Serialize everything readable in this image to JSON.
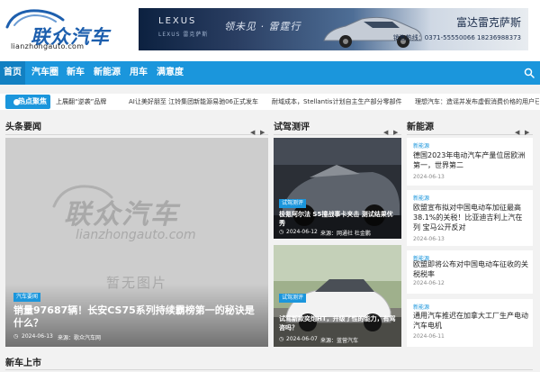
{
  "logo": {
    "text": "联众汽车",
    "url": "lianzhongauto.com",
    "icon": "car-logo-icon",
    "color": "#1d5fae"
  },
  "banner": {
    "brand": "LEXUS",
    "brand_sub": "LEXUS 雷克萨斯",
    "slogan": "领未见 · 雷霆行",
    "dealer": "富达雷克萨斯",
    "phone": "销售热线：0371-55550066 18236988373"
  },
  "nav": {
    "items": [
      "首页",
      "汽车圈",
      "新车",
      "新能源",
      "用车",
      "满意度"
    ],
    "active": "首页",
    "search_icon": "search-icon",
    "color": "#1b96dc"
  },
  "ticker": {
    "label": "热点聚焦",
    "items": [
      "上展翻“逆袭”品牌",
      "AI让美好朋至 江铃集团新能源易驰06正式发车",
      "耐域成本，Stellantis计划自主生产部分零部件",
      "理想汽车：造谣并发布虚假消费价格的用户已经被"
    ]
  },
  "sections": {
    "headline": "头条要闻",
    "test_drive": "试驾测评",
    "new_energy": "新能源",
    "new_cars": "新车上市"
  },
  "feature": {
    "placeholder_logo": "联众汽车",
    "placeholder_url": "lianzhongauto.com",
    "placeholder_text": "暂无图片",
    "tag": "汽车要闻",
    "title": "销量97687辆！长安CS75系列持续霸榜第一的秘诀是什么？",
    "date": "2024-06-13",
    "source": "来源：歌众汽车网"
  },
  "test_drive": [
    {
      "tag": "试驾测评",
      "title": "极氪阿尔法 S5撞战事卡夹击 测试结果优秀",
      "date": "2024-06-12",
      "source": "来源：网通社 杜金鹏"
    },
    {
      "tag": "试驾测评",
      "title": "试驾新款奕炮HT，升级了性的能力，有驾咨吗？",
      "date": "2024-06-07",
      "source": "来源：蓝营汽车"
    }
  ],
  "new_energy": [
    {
      "tag": "新能源",
      "title": "德国2023年电动汽车产量位居欧洲第一，世界第二",
      "date": "2024-06-13"
    },
    {
      "tag": "新能源",
      "title": "欧盟宣布拟对中国电动车加征最高38.1%的关税！比亚迪吉利上汽在列 宝马公开反对",
      "date": "2024-06-13"
    },
    {
      "tag": "新能源",
      "title": "欧盟即将公布对中国电动车征收的关税税率",
      "date": "2024-06-12"
    },
    {
      "tag": "新能源",
      "title": "通用汽车推迟在加拿大工厂生产电动汽车电机",
      "date": "2024-06-11"
    }
  ],
  "arrows": {
    "left": "◀",
    "right": "▶"
  }
}
